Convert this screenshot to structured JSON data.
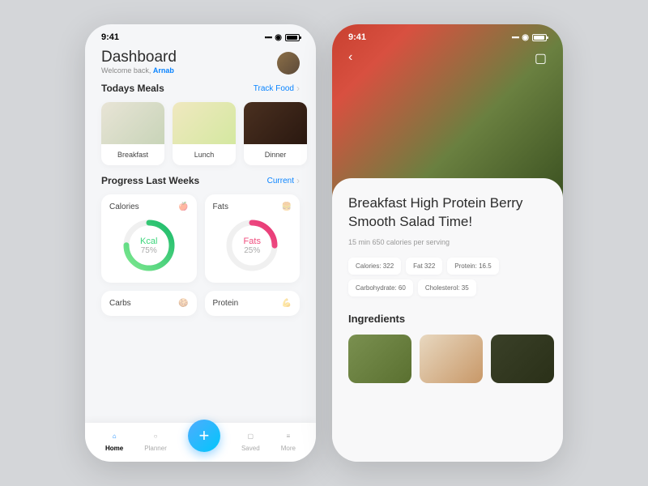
{
  "status": {
    "time": "9:41"
  },
  "dashboard": {
    "title": "Dashboard",
    "welcome_prefix": "Welcome back, ",
    "user_name": "Arnab",
    "meals_heading": "Todays Meals",
    "track_food": "Track Food",
    "meals": [
      {
        "label": "Breakfast"
      },
      {
        "label": "Lunch"
      },
      {
        "label": "Dinner"
      }
    ],
    "progress_heading": "Progress Last Weeks",
    "progress_link": "Current",
    "cards": {
      "calories": {
        "title": "Calories",
        "ring_label": "Kcal",
        "pct": "75%",
        "value": 75
      },
      "fats": {
        "title": "Fats",
        "ring_label": "Fats",
        "pct": "25%",
        "value": 25
      },
      "carbs": {
        "title": "Carbs"
      },
      "protein": {
        "title": "Protein"
      }
    },
    "nav": {
      "home": "Home",
      "planner": "Planner",
      "saved": "Saved",
      "more": "More"
    }
  },
  "recipe": {
    "title": "Breakfast High Protein Berry Smooth Salad Time!",
    "subtitle": "15 min 650 calories per serving",
    "chips": [
      "Calories: 322",
      "Fat 322",
      "Protein: 16.5",
      "Carbohydrate: 60",
      "Cholesterol: 35"
    ],
    "ingredients_heading": "Ingredients"
  }
}
